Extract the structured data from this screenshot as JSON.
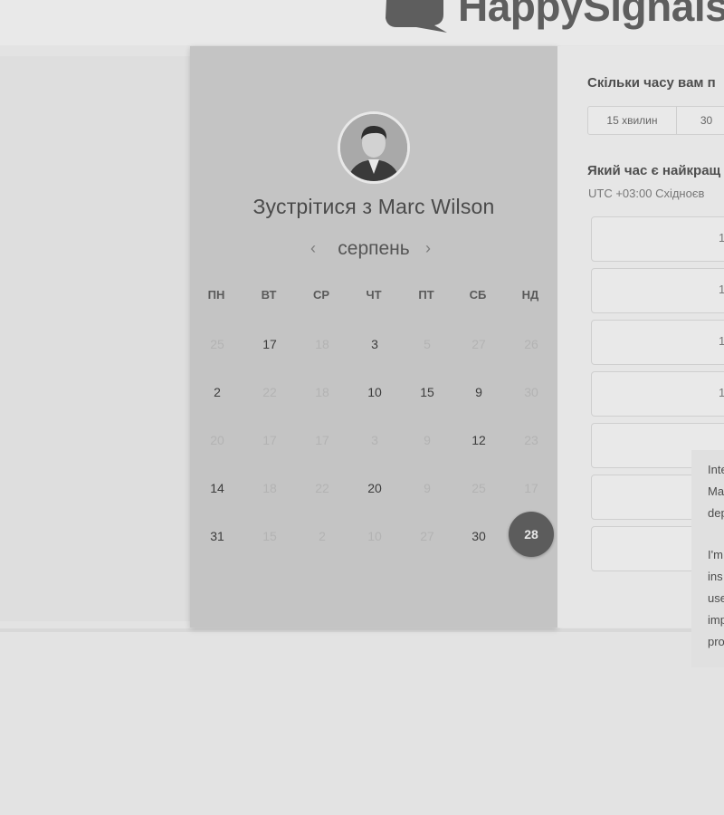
{
  "header": {
    "logo_text": "HappySignals"
  },
  "card": {
    "title": "Зустрітися з Marc Wilson",
    "month": "серпень",
    "prev_icon": "chevron-left-icon",
    "next_icon": "chevron-right-icon",
    "weekdays": [
      "ПН",
      "ВТ",
      "СР",
      "ЧТ",
      "ПТ",
      "СБ",
      "НД"
    ],
    "weeks": [
      [
        {
          "d": "25",
          "a": false
        },
        {
          "d": "17",
          "a": true
        },
        {
          "d": "18",
          "a": false
        },
        {
          "d": "3",
          "a": true
        },
        {
          "d": "5",
          "a": false
        },
        {
          "d": "27",
          "a": false
        },
        {
          "d": "26",
          "a": false
        }
      ],
      [
        {
          "d": "2",
          "a": true
        },
        {
          "d": "22",
          "a": false
        },
        {
          "d": "18",
          "a": false
        },
        {
          "d": "10",
          "a": true
        },
        {
          "d": "15",
          "a": true
        },
        {
          "d": "9",
          "a": true
        },
        {
          "d": "30",
          "a": false
        }
      ],
      [
        {
          "d": "20",
          "a": false
        },
        {
          "d": "17",
          "a": false
        },
        {
          "d": "17",
          "a": false
        },
        {
          "d": "3",
          "a": false
        },
        {
          "d": "9",
          "a": false
        },
        {
          "d": "12",
          "a": true
        },
        {
          "d": "23",
          "a": false
        }
      ],
      [
        {
          "d": "14",
          "a": true
        },
        {
          "d": "18",
          "a": false
        },
        {
          "d": "22",
          "a": false
        },
        {
          "d": "20",
          "a": true
        },
        {
          "d": "9",
          "a": false
        },
        {
          "d": "25",
          "a": false
        },
        {
          "d": "17",
          "a": false
        }
      ],
      [
        {
          "d": "31",
          "a": true
        },
        {
          "d": "15",
          "a": false
        },
        {
          "d": "2",
          "a": false
        },
        {
          "d": "10",
          "a": false
        },
        {
          "d": "27",
          "a": false
        },
        {
          "d": "30",
          "a": true
        },
        {
          "d": "28",
          "a": true,
          "selected": true
        }
      ]
    ]
  },
  "booking": {
    "duration_question": "Скільки часу вам п",
    "durations": [
      "15 хвилин",
      "30"
    ],
    "time_question": "Який час є найкращ",
    "timezone": "UTC +03:00 Східноєв",
    "slots": [
      "1",
      "1",
      "1",
      "1",
      "",
      "",
      ""
    ]
  },
  "bio": {
    "para1": [
      "Inte",
      "Ma",
      "dep"
    ],
    "para2": [
      "I'm",
      "ins",
      "use",
      "imp",
      "pro"
    ]
  }
}
